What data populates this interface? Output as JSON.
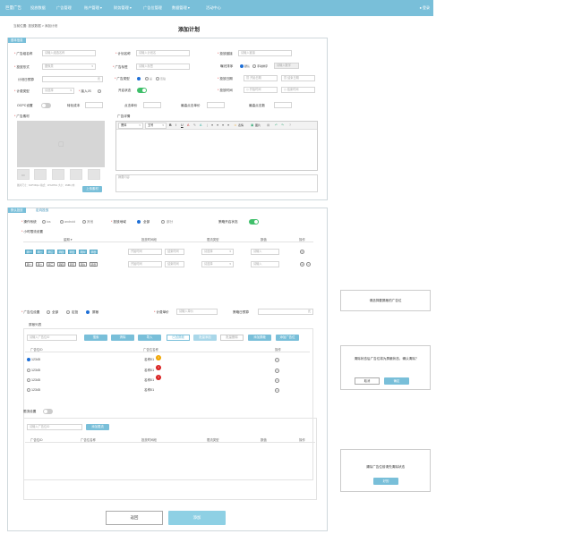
{
  "topbar": {
    "logo": "巨量广告",
    "nav": [
      "投放数据",
      "广告管理",
      "账户管理 ▾",
      "财务管理 ▾",
      "广告位管理",
      "数据管理 ▾",
      "活动中心"
    ],
    "user": "登录"
  },
  "breadcrumb": "当前位置: 投放数据 > 添加计划",
  "page_title": "添加计划",
  "basic": {
    "tag": "基本信息",
    "ad_group_label": "广告组名称",
    "ad_group_placeholder": "请输入组选名称",
    "plan_name_label": "计划名称",
    "plan_name_placeholder": "请输入计划名",
    "link_label": "投放链接",
    "link_placeholder": "请输入链接",
    "form_label": "投放形式",
    "form_value": "图像类",
    "ad_tag_label": "广告标签",
    "ad_tag_placeholder": "请输入标签",
    "exposure_label": "曝光排序",
    "exposure_opt1": "默认",
    "exposure_opt2": "手动排序",
    "exposure_placeholder": "请输入数字",
    "daily_budget_label": "计划日预算",
    "ad_type_label": "广告类型",
    "ad_type_opt1": "是",
    "ad_type_opt2": "否贴",
    "date_label": "投放日期",
    "date_start": "开始日期",
    "date_end": "结束日期",
    "billing_label": "计费类型",
    "billing_value": "请选择",
    "js_label": "接入JS",
    "status_label": "开启状态",
    "time_label": "投放时间",
    "time_start": "开始时间",
    "time_end": "结束时间",
    "ocpc_label": "OCPC设置",
    "conv_cost_label": "转化成本",
    "click_price_label": "点击单价",
    "max_click_label": "最高点击单价",
    "max_clicks_label": "最高点击数",
    "material_label": "广告素材",
    "material_hint": "图片尺寸：640*360px 格式：JPG/PNG 大小：2MB以内",
    "upload_btn": "上传素材",
    "detail_label": "广告详情",
    "editor_font": "黑体",
    "editor_size": "五号",
    "editor_emoji": "表情",
    "editor_image": "图片",
    "summary_placeholder": "摘要内容"
  },
  "targeting": {
    "tab1": "默认投放",
    "tab2": "定向投放",
    "os_label": "操作系统",
    "os_opts": [
      "ios",
      "android",
      "其他"
    ],
    "region_label": "投放地域",
    "region_opts": [
      "全部",
      "部分"
    ],
    "strategy_label": "策略开启状态",
    "hours_label": "小时限流设置",
    "hours_cols": [
      "星期 ▾",
      "投放时间段",
      "限流类型",
      "数值",
      "操作"
    ],
    "days_row1": [
      "周一",
      "周二",
      "周三",
      "周四",
      "周五",
      "周六",
      "周日"
    ],
    "days_row2": [
      "周一",
      "周二",
      "周三",
      "周四",
      "周五",
      "周六",
      "周日"
    ],
    "start_time": "开始时间",
    "end_time": "结束时间",
    "limit_type": "请选择",
    "limit_value": "请输入"
  },
  "adslot": {
    "settings_label": "广告位设置",
    "opts": [
      "全部",
      "定投",
      "屏蔽"
    ],
    "price_label": "计费单价",
    "price_placeholder": "请输入单价",
    "budget_label": "策略日预算",
    "list_tab": "屏蔽列表",
    "search_placeholder": "请输入广告位ID",
    "search_btn": "搜索",
    "clear_btn": "清除",
    "import_btn": "导入",
    "b1": "已选屏蔽",
    "b2": "批量添加",
    "b3": "批量删除",
    "b4": "添加屏蔽",
    "b5": "添加广告位",
    "cols": [
      "广告位ID",
      "广告位名称",
      "操作"
    ],
    "rows": [
      {
        "id": "12345",
        "name": "名称01"
      },
      {
        "id": "12345",
        "name": "名称01"
      },
      {
        "id": "12345",
        "name": "名称01"
      },
      {
        "id": "12345",
        "name": "名称01"
      }
    ]
  },
  "flow": {
    "label": "限流设置",
    "search_placeholder": "请输入广告位ID",
    "add_btn": "添加限流",
    "cols": [
      "广告位ID",
      "广告位名称",
      "投放时间段",
      "限流类型",
      "数值",
      "操作"
    ]
  },
  "footer": {
    "back": "返回",
    "add": "添加"
  },
  "dialogs": {
    "d1_text": "请选择要屏蔽的广告位",
    "d2_text": "清除状态后广告位将为屏蔽状态，确认清除？",
    "d2_cancel": "取消",
    "d2_ok": "确定",
    "d3_text": "清除广告位前请先清除状态",
    "d3_ok": "好的"
  }
}
